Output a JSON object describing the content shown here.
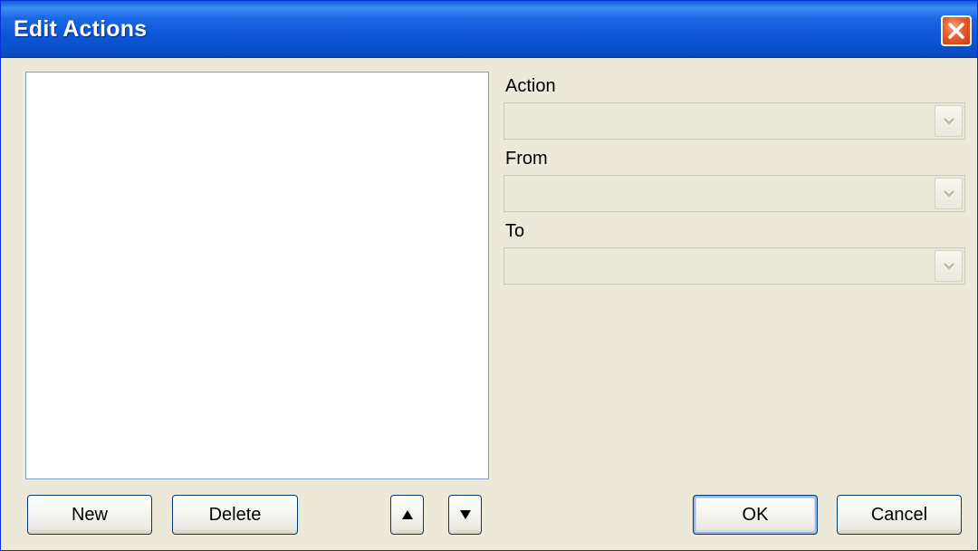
{
  "window": {
    "title": "Edit Actions"
  },
  "list": {
    "items": []
  },
  "fields": {
    "action": {
      "label": "Action",
      "value": ""
    },
    "from": {
      "label": "From",
      "value": ""
    },
    "to": {
      "label": "To",
      "value": ""
    }
  },
  "buttons": {
    "new": "New",
    "delete": "Delete",
    "move_up_icon": "triangle-up",
    "move_down_icon": "triangle-down",
    "ok": "OK",
    "cancel": "Cancel"
  },
  "colors": {
    "titlebar": "#0d57d8",
    "dialog_bg": "#ece9d8",
    "close_button": "#e55c2c",
    "default_button_focus": "#9db4e8"
  }
}
